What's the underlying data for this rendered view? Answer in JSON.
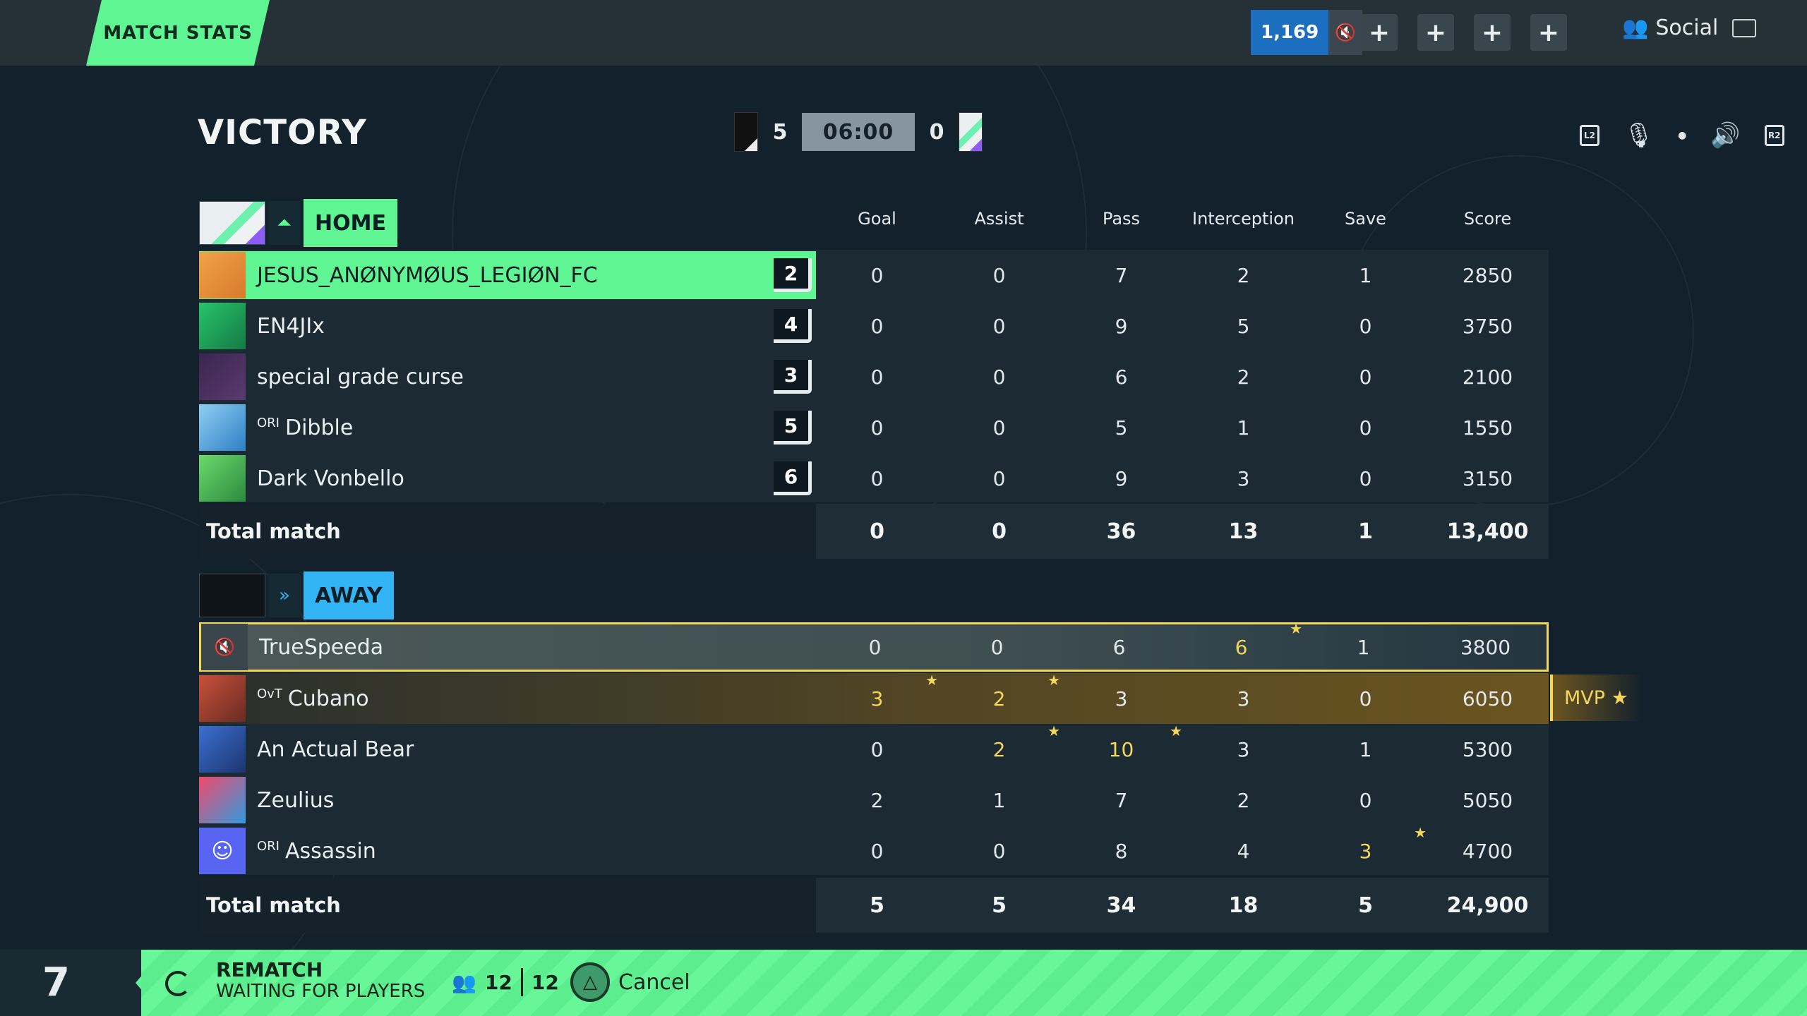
{
  "top": {
    "tab": "MATCH STATS",
    "coins": "1,169",
    "social": "Social"
  },
  "header": {
    "result": "VICTORY",
    "home_score": "5",
    "timer": "06:00",
    "away_score": "0",
    "right_icons": [
      "L2",
      "mic-muted-icon",
      "dot",
      "speaker-icon",
      "R2"
    ]
  },
  "columns": [
    "Goal",
    "Assist",
    "Pass",
    "Interception",
    "Save",
    "Score"
  ],
  "home": {
    "label": "HOME",
    "players": [
      {
        "tag": "",
        "name": "JESUS_ANØNYMØUS_LEGIØN_FC",
        "level": "2",
        "stats": [
          "0",
          "0",
          "7",
          "2",
          "1",
          "2850"
        ]
      },
      {
        "tag": "",
        "name": "EN4JIx",
        "level": "4",
        "stats": [
          "0",
          "0",
          "9",
          "5",
          "0",
          "3750"
        ]
      },
      {
        "tag": "",
        "name": "special grade curse",
        "level": "3",
        "stats": [
          "0",
          "0",
          "6",
          "2",
          "0",
          "2100"
        ]
      },
      {
        "tag": "ORI",
        "name": "Dibble",
        "level": "5",
        "stats": [
          "0",
          "0",
          "5",
          "1",
          "0",
          "1550"
        ]
      },
      {
        "tag": "",
        "name": "Dark Vonbello",
        "level": "6",
        "stats": [
          "0",
          "0",
          "9",
          "3",
          "0",
          "3150"
        ]
      }
    ],
    "total_label": "Total match",
    "totals": [
      "0",
      "0",
      "36",
      "13",
      "1",
      "13,400"
    ]
  },
  "away": {
    "label": "AWAY",
    "players": [
      {
        "tag": "",
        "name": "TrueSpeeda",
        "stats": [
          "0",
          "0",
          "6",
          "6",
          "1",
          "3800"
        ]
      },
      {
        "tag": "OvT",
        "name": "Cubano",
        "stats": [
          "3",
          "2",
          "3",
          "3",
          "0",
          "6050"
        ]
      },
      {
        "tag": "",
        "name": "An Actual Bear",
        "stats": [
          "0",
          "2",
          "10",
          "3",
          "1",
          "5300"
        ]
      },
      {
        "tag": "",
        "name": "Zeulius",
        "stats": [
          "2",
          "1",
          "7",
          "2",
          "0",
          "5050"
        ]
      },
      {
        "tag": "ORI",
        "name": "Assassin",
        "stats": [
          "0",
          "0",
          "8",
          "4",
          "3",
          "4700"
        ]
      }
    ],
    "total_label": "Total match",
    "totals": [
      "5",
      "5",
      "34",
      "18",
      "5",
      "24,900"
    ]
  },
  "mvp": "MVP ★",
  "bottom": {
    "count": "7",
    "rematch": "REMATCH",
    "waiting": "WAITING FOR PLAYERS",
    "players_a": "12",
    "players_b": "12",
    "cancel": "Cancel"
  },
  "colors": {
    "accent": "#5ef592",
    "away": "#33b5f5",
    "highlight": "#f4d65c"
  }
}
